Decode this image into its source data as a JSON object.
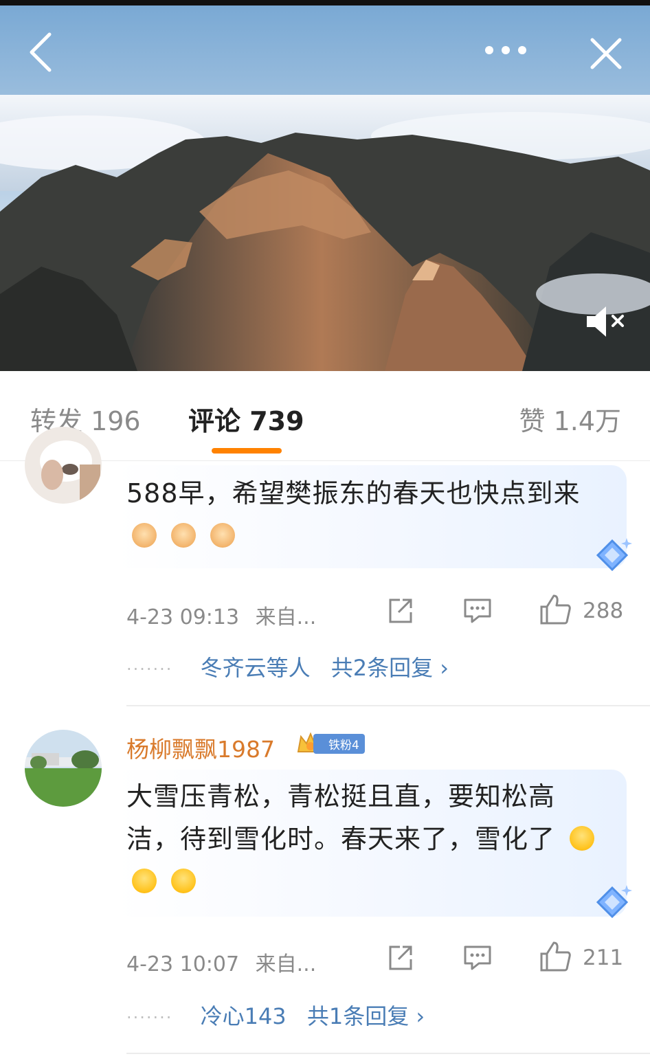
{
  "tabs": {
    "repost": "转发 196",
    "comments": "评论 739",
    "likes": "赞 1.4万"
  },
  "icons": {
    "back": "chevron-left-icon",
    "more": "more-dots-icon",
    "close": "close-icon",
    "mute": "speaker-muted-icon",
    "share": "share-icon",
    "reply": "comment-icon",
    "like": "thumbs-up-icon"
  },
  "colors": {
    "accent": "#ff8200",
    "link": "#4a7db5",
    "username": "#d97a2b",
    "badge": "#5a8fd8"
  },
  "comments": [
    {
      "text": "588早，希望樊振东的春天也快点到来",
      "emojis": [
        "fist",
        "fist",
        "fist"
      ],
      "time": "4-23 09:13",
      "source": "来自...",
      "likes": "288",
      "reply_names": "冬齐云等人",
      "reply_count": "共2条回复 ›"
    },
    {
      "username": "杨柳飘飘1987",
      "badge": "铁粉4",
      "text": "大雪压青松，青松挺且直，要知松高洁，待到雪化时。春天来了，雪化了",
      "emojis": [
        "hug",
        "hug",
        "hug"
      ],
      "time": "4-23 10:07",
      "source": "来自...",
      "likes": "211",
      "reply_names": "冷心143",
      "reply_count": "共1条回复 ›"
    }
  ]
}
